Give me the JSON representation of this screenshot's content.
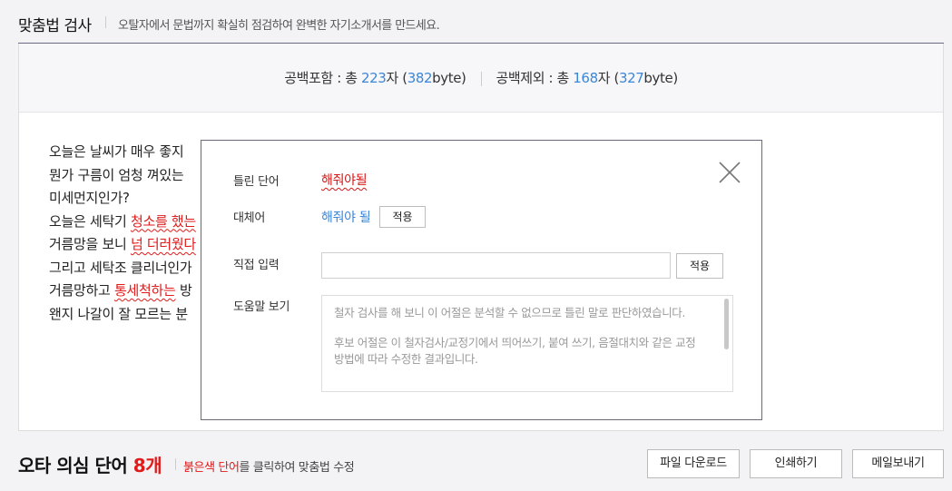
{
  "header": {
    "title": "맞춤법 검사",
    "subtitle": "오탈자에서 문법까지 확실히 점검하여 완벽한 자기소개서를 만드세요."
  },
  "counts": {
    "with_space_label": "공백포함",
    "with_space_prefix": " : 총 ",
    "with_space_chars": "223",
    "chars_unit": "자",
    "with_space_bytes": "382",
    "bytes_unit": "byte",
    "without_space_label": "공백제외",
    "without_space_prefix": " : 총 ",
    "without_space_chars": "168",
    "without_space_bytes": "327"
  },
  "document": {
    "lines": [
      {
        "parts": [
          {
            "t": "오늘은 날씨가 매우 좋지",
            "err": false
          }
        ]
      },
      {
        "parts": [
          {
            "t": "뭔가 구름이 엄청 껴있는",
            "err": false
          }
        ]
      },
      {
        "parts": [
          {
            "t": "미세먼지인가?",
            "err": false
          }
        ]
      },
      {
        "parts": [
          {
            "t": "오늘은 세탁기 ",
            "err": false
          },
          {
            "t": "청소를 했는",
            "err": true
          }
        ]
      },
      {
        "parts": [
          {
            "t": "거름망을 보니 ",
            "err": false
          },
          {
            "t": "넘 더러웠다",
            "err": true
          }
        ]
      },
      {
        "parts": [
          {
            "t": "그리고 세탁조 클리너인가",
            "err": false
          }
        ]
      },
      {
        "parts": [
          {
            "t": "거름망하고 ",
            "err": false
          },
          {
            "t": "통세척하는",
            "err": true
          },
          {
            "t": " 방",
            "err": false
          }
        ]
      },
      {
        "parts": [
          {
            "t": "왠지 나갈이 잘 모르는 분",
            "err": false
          }
        ]
      }
    ]
  },
  "modal": {
    "wrong_label": "틀린 단어",
    "wrong_word": "해줘야될",
    "replace_label": "대체어",
    "suggestion": "해줘야 될",
    "apply_label": "적용",
    "direct_label": "직접 입력",
    "direct_value": "",
    "direct_placeholder": "",
    "direct_apply_label": "적용",
    "help_label": "도움말 보기",
    "help_paragraphs": [
      "철자 검사를 해 보니 이 어절은 분석할 수 없으므로 틀린 말로 판단하였습니다.",
      "후보 어절은 이 철자검사/교정기에서 띄어쓰기, 붙여 쓰기, 음절대치와 같은 교정방법에 따라 수정한 결과입니다."
    ],
    "close_icon": "close-x-icon"
  },
  "footer": {
    "title": "오타 의심 단어 ",
    "error_count": "8개",
    "hint_red": "붉은색 단어",
    "hint_rest": "를 클릭하여 맞춤법 수정",
    "buttons": {
      "download": "파일 다운로드",
      "print": "인쇄하기",
      "email": "메일보내기"
    }
  },
  "colors": {
    "accent_blue": "#3b86d8",
    "error_red": "#e11a1a"
  }
}
